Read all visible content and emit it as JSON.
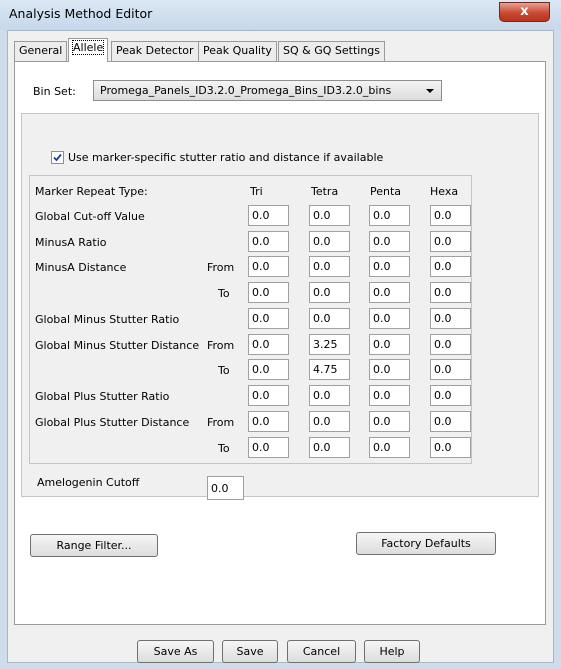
{
  "window": {
    "title": "Analysis Method Editor",
    "close_label": "x"
  },
  "tabs": [
    {
      "label": "General",
      "active": false
    },
    {
      "label": "Allele",
      "active": true
    },
    {
      "label": "Peak Detector",
      "active": false
    },
    {
      "label": "Peak Quality",
      "active": false
    },
    {
      "label": "SQ & GQ Settings",
      "active": false
    }
  ],
  "bin_set": {
    "label": "Bin Set:",
    "value": "Promega_Panels_ID3.2.0_Promega_Bins_ID3.2.0_bins"
  },
  "stutter_option": {
    "label": "Use marker-specific stutter ratio and distance if available",
    "checked": true
  },
  "table": {
    "header_label": "Marker Repeat Type:",
    "columns": [
      "Tri",
      "Tetra",
      "Penta",
      "Hexa"
    ],
    "rows": [
      {
        "label": "Global Cut-off Value",
        "sub": "",
        "values": [
          "0.0",
          "0.0",
          "0.0",
          "0.0"
        ]
      },
      {
        "label": "MinusA Ratio",
        "sub": "",
        "values": [
          "0.0",
          "0.0",
          "0.0",
          "0.0"
        ]
      },
      {
        "label": "MinusA Distance",
        "sub": "From",
        "values": [
          "0.0",
          "0.0",
          "0.0",
          "0.0"
        ]
      },
      {
        "label": "",
        "sub": "To",
        "values": [
          "0.0",
          "0.0",
          "0.0",
          "0.0"
        ]
      },
      {
        "label": "Global Minus Stutter Ratio",
        "sub": "",
        "values": [
          "0.0",
          "0.0",
          "0.0",
          "0.0"
        ]
      },
      {
        "label": "Global Minus Stutter Distance",
        "sub": "From",
        "values": [
          "0.0",
          "3.25",
          "0.0",
          "0.0"
        ]
      },
      {
        "label": "",
        "sub": "To",
        "values": [
          "0.0",
          "4.75",
          "0.0",
          "0.0"
        ]
      },
      {
        "label": "Global Plus Stutter Ratio",
        "sub": "",
        "values": [
          "0.0",
          "0.0",
          "0.0",
          "0.0"
        ]
      },
      {
        "label": "Global Plus Stutter Distance",
        "sub": "From",
        "values": [
          "0.0",
          "0.0",
          "0.0",
          "0.0"
        ]
      },
      {
        "label": "",
        "sub": "To",
        "values": [
          "0.0",
          "0.0",
          "0.0",
          "0.0"
        ]
      }
    ]
  },
  "amelogenin": {
    "label": "Amelogenin Cutoff",
    "value": "0.0"
  },
  "buttons": {
    "range_filter": "Range Filter...",
    "factory_defaults": "Factory Defaults",
    "save_as": "Save As",
    "save": "Save",
    "cancel": "Cancel",
    "help": "Help"
  }
}
